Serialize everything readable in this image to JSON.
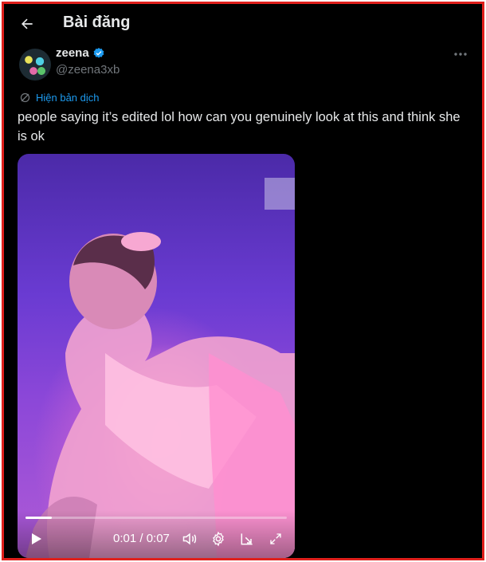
{
  "header": {
    "title": "Bài đăng"
  },
  "author": {
    "name": "zeena",
    "handle": "@zeena3xb"
  },
  "tweet": {
    "translate_label": "Hiện bản dịch",
    "text": "people saying it’s edited lol how can you genuinely look at this and think she is ok"
  },
  "video": {
    "time_display": "0:01 / 0:07",
    "progress": 0.1
  },
  "colors": {
    "accent": "#1d9bf0",
    "background": "#000000",
    "border": "#e0201c"
  }
}
